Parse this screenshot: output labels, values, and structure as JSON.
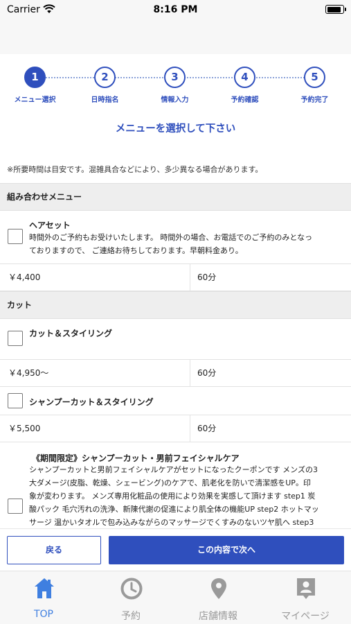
{
  "status_bar": {
    "carrier": "Carrier",
    "time": "8:16 PM"
  },
  "steps": [
    {
      "number": "1",
      "label": "メニュー選択",
      "active": true
    },
    {
      "number": "2",
      "label": "日時指名",
      "active": false
    },
    {
      "number": "3",
      "label": "情報入力",
      "active": false
    },
    {
      "number": "4",
      "label": "予約確認",
      "active": false
    },
    {
      "number": "5",
      "label": "予約完了",
      "active": false
    }
  ],
  "page_title": "メニューを選択して下さい",
  "notice": "※所要時間は目安です。混雑具合などにより、多少異なる場合があります。",
  "sections": [
    {
      "header": "組み合わせメニュー",
      "items": [
        {
          "title": "ヘアセット",
          "description_lines": [
            "時間外のご予約もお受けいたします。 時間外の場合、お電話でのご予約のみとなっ",
            "ておりますので、 ご連絡お待ちしております。早朝料金あり。"
          ],
          "price": "￥4,400",
          "duration": "60分"
        }
      ]
    },
    {
      "header": "カット",
      "items": [
        {
          "title": "カット＆スタイリング",
          "price": "￥4,950〜",
          "duration": "60分"
        },
        {
          "title": "シャンプーカット＆スタイリング",
          "price": "￥5,500",
          "duration": "60分"
        },
        {
          "title": "《期間限定》シャンプーカット・男前フェイシャルケア",
          "description_lines": [
            "シャンプーカットと男前フェイシャルケアがセットになったクーポンです メンズの3",
            "大ダメージ(皮脂、乾燥、シェービング)のケアで、肌老化を防いで清潔感をUP。印",
            "象が変わります。 メンズ専用化粧品の使用により効果を実感して頂けます step1 炭",
            "酸パック 毛穴汚れの洗浄、新陳代謝の促進により肌全体の機能UP step2 ホットマッ",
            "サージ 温かいタオルで包み込みながらのマッサージでくすみのないツヤ肌へ step3"
          ]
        }
      ]
    }
  ],
  "actions": {
    "back_label": "戻る",
    "next_label": "この内容で次へ"
  },
  "tab_bar": [
    {
      "label": "TOP",
      "icon": "home-icon",
      "active": true
    },
    {
      "label": "予約",
      "icon": "clock-icon",
      "active": false
    },
    {
      "label": "店舗情報",
      "icon": "map-pin-icon",
      "active": false
    },
    {
      "label": "マイページ",
      "icon": "person-badge-icon",
      "active": false
    }
  ],
  "colors": {
    "accent": "#2f4fbd",
    "tab_active": "#3f7fe0",
    "tab_inactive": "#9a9a9a"
  }
}
